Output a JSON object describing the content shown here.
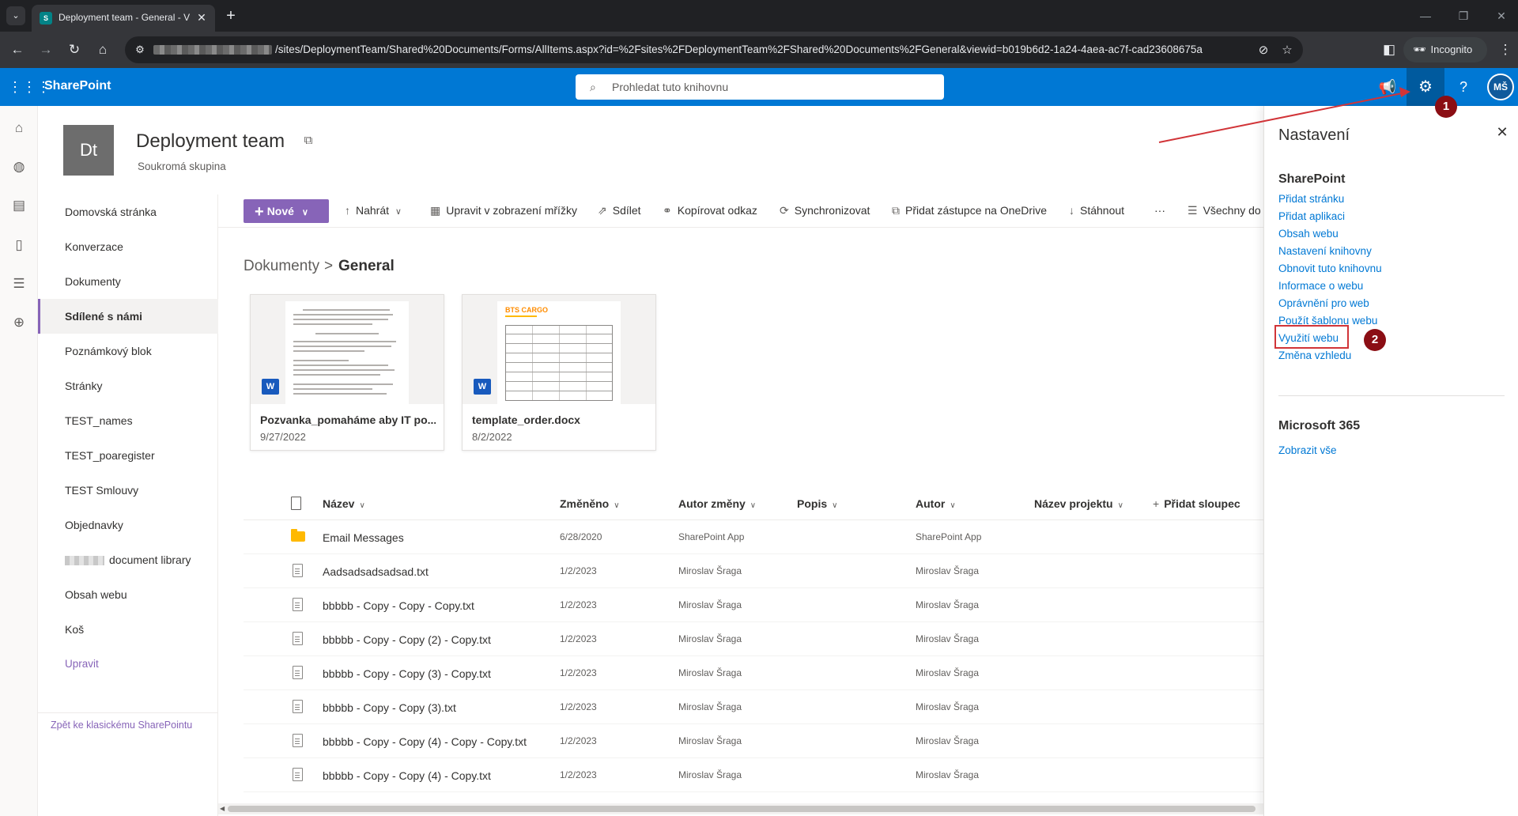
{
  "browser": {
    "tab_title": "Deployment team - General - V",
    "favicon": "S",
    "url_visible": "/sites/DeploymentTeam/Shared%20Documents/Forms/AllItems.aspx?id=%2Fsites%2FDeploymentTeam%2FShared%20Documents%2FGeneral&viewid=b019b6d2-1a24-4aea-ac7f-cad23608675a",
    "incognito_label": "Incognito"
  },
  "suitebar": {
    "brand": "SharePoint",
    "search_placeholder": "Prohledat tuto knihovnu",
    "avatar_initials": "MŠ",
    "accent": "#0078d4"
  },
  "site": {
    "logo_initials": "Dt",
    "title": "Deployment team",
    "subtitle": "Soukromá skupina"
  },
  "leftnav": {
    "items": [
      {
        "label": "Domovská stránka"
      },
      {
        "label": "Konverzace"
      },
      {
        "label": "Dokumenty"
      },
      {
        "label": "Sdílené s námi",
        "selected": true
      },
      {
        "label": "Poznámkový blok"
      },
      {
        "label": "Stránky"
      },
      {
        "label": "TEST_names"
      },
      {
        "label": "TEST_poaregister"
      },
      {
        "label": "TEST Smlouvy"
      },
      {
        "label": "Objednavky"
      },
      {
        "label": "document library"
      },
      {
        "label": "Obsah webu"
      },
      {
        "label": "Koš"
      }
    ],
    "edit_label": "Upravit",
    "classic_link": "Zpět ke klasickému SharePointu"
  },
  "commandbar": {
    "new": "Nové",
    "upload": "Nahrát",
    "grid_edit": "Upravit v zobrazení mřížky",
    "share": "Sdílet",
    "copy_link": "Kopírovat odkaz",
    "sync": "Synchronizovat",
    "onedrive": "Přidat zástupce na OneDrive",
    "download": "Stáhnout",
    "more": "···",
    "all_docs": "Všechny do"
  },
  "breadcrumb": {
    "root": "Dokumenty",
    "separator": ">",
    "current": "General"
  },
  "cards": [
    {
      "name": "Pozvanka_pomaháme aby IT po...",
      "date": "9/27/2022"
    },
    {
      "name": "template_order.docx",
      "date": "8/2/2022",
      "thumb_title": "BTS CARGO"
    }
  ],
  "list": {
    "columns": {
      "name": "Název",
      "modified": "Změněno",
      "modified_by": "Autor změny",
      "description": "Popis",
      "author": "Autor",
      "project": "Název projektu",
      "add_column": "Přidat sloupec"
    },
    "rows": [
      {
        "type": "folder",
        "name": "Email Messages",
        "modified": "6/28/2020",
        "modified_by": "SharePoint App",
        "author": "SharePoint App"
      },
      {
        "type": "file",
        "name": "Aadsadsadsadsad.txt",
        "modified": "1/2/2023",
        "modified_by": "Miroslav Šraga",
        "author": "Miroslav Šraga"
      },
      {
        "type": "file",
        "name": "bbbbb - Copy - Copy - Copy.txt",
        "modified": "1/2/2023",
        "modified_by": "Miroslav Šraga",
        "author": "Miroslav Šraga"
      },
      {
        "type": "file",
        "name": "bbbbb - Copy - Copy (2) - Copy.txt",
        "modified": "1/2/2023",
        "modified_by": "Miroslav Šraga",
        "author": "Miroslav Šraga"
      },
      {
        "type": "file",
        "name": "bbbbb - Copy - Copy (3) - Copy.txt",
        "modified": "1/2/2023",
        "modified_by": "Miroslav Šraga",
        "author": "Miroslav Šraga"
      },
      {
        "type": "file",
        "name": "bbbbb - Copy - Copy (3).txt",
        "modified": "1/2/2023",
        "modified_by": "Miroslav Šraga",
        "author": "Miroslav Šraga"
      },
      {
        "type": "file",
        "name": "bbbbb - Copy - Copy (4) - Copy - Copy.txt",
        "modified": "1/2/2023",
        "modified_by": "Miroslav Šraga",
        "author": "Miroslav Šraga"
      },
      {
        "type": "file",
        "name": "bbbbb - Copy - Copy (4) - Copy.txt",
        "modified": "1/2/2023",
        "modified_by": "Miroslav Šraga",
        "author": "Miroslav Šraga"
      }
    ]
  },
  "settings_panel": {
    "title": "Nastavení",
    "sharepoint_heading": "SharePoint",
    "links": [
      "Přidat stránku",
      "Přidat aplikaci",
      "Obsah webu",
      "Nastavení knihovny",
      "Obnovit tuto knihovnu",
      "Informace o webu",
      "Oprávnění pro web",
      "Použít šablonu webu",
      "Využití webu",
      "Změna vzhledu"
    ],
    "m365_heading": "Microsoft 365",
    "m365_link": "Zobrazit vše"
  },
  "annotations": {
    "badge1": "1",
    "badge2": "2",
    "color": "#8b0e14"
  }
}
